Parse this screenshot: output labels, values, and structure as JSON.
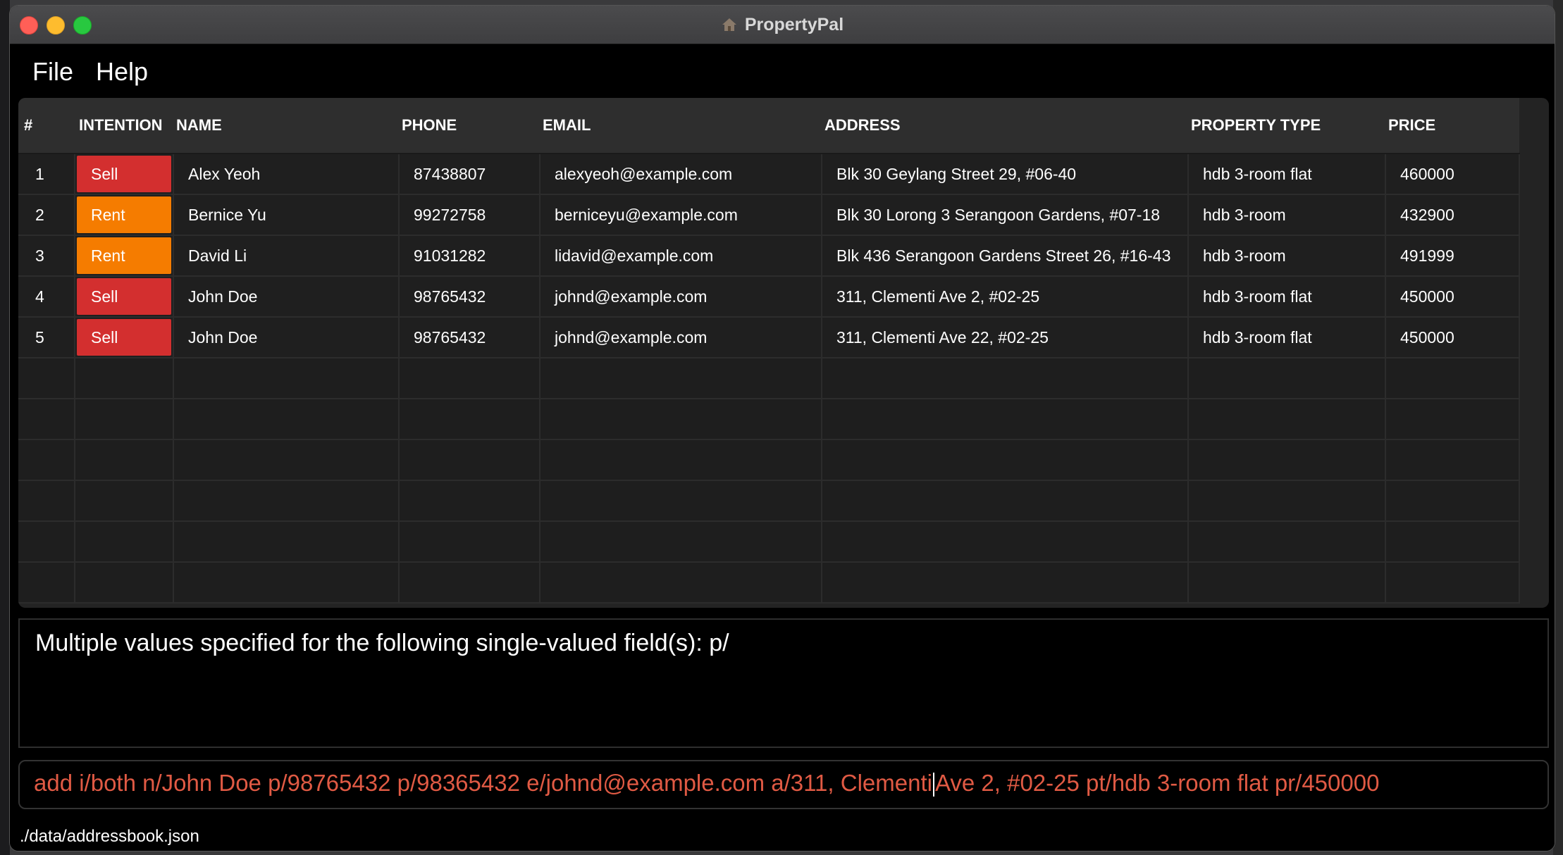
{
  "window": {
    "title": "PropertyPal",
    "icon": "house-icon"
  },
  "menu": {
    "items": [
      "File",
      "Help"
    ]
  },
  "colors": {
    "sell": "#d32f2f",
    "rent": "#f57c00",
    "command_text": "#e05a44"
  },
  "table": {
    "columns": [
      "#",
      "INTENTION",
      "NAME",
      "PHONE",
      "EMAIL",
      "ADDRESS",
      "PROPERTY TYPE",
      "PRICE"
    ],
    "rows": [
      {
        "index": "1",
        "intention": "Sell",
        "name": "Alex Yeoh",
        "phone": "87438807",
        "email": "alexyeoh@example.com",
        "address": "Blk 30 Geylang Street 29, #06-40",
        "property_type": "hdb 3-room flat",
        "price": "460000"
      },
      {
        "index": "2",
        "intention": "Rent",
        "name": "Bernice Yu",
        "phone": "99272758",
        "email": "berniceyu@example.com",
        "address": "Blk 30 Lorong 3 Serangoon Gardens, #07-18",
        "property_type": "hdb 3-room",
        "price": "432900"
      },
      {
        "index": "3",
        "intention": "Rent",
        "name": "David Li",
        "phone": "91031282",
        "email": "lidavid@example.com",
        "address": "Blk 436 Serangoon Gardens Street 26, #16-43",
        "property_type": "hdb 3-room",
        "price": "491999"
      },
      {
        "index": "4",
        "intention": "Sell",
        "name": "John Doe",
        "phone": "98765432",
        "email": "johnd@example.com",
        "address": "311, Clementi Ave 2, #02-25",
        "property_type": "hdb 3-room flat",
        "price": "450000"
      },
      {
        "index": "5",
        "intention": "Sell",
        "name": "John Doe",
        "phone": "98765432",
        "email": "johnd@example.com",
        "address": "311, Clementi Ave 22, #02-25",
        "property_type": "hdb 3-room flat",
        "price": "450000"
      }
    ]
  },
  "result": {
    "message": "Multiple values specified for the following single-valued field(s): p/"
  },
  "command": {
    "before_caret": "add i/both n/John Doe p/98765432 p/98365432 e/johnd@example.com a/311, Clementi",
    "after_caret": "Ave 2, #02-25 pt/hdb 3-room flat pr/450000"
  },
  "status": {
    "file_path": "./data/addressbook.json"
  }
}
